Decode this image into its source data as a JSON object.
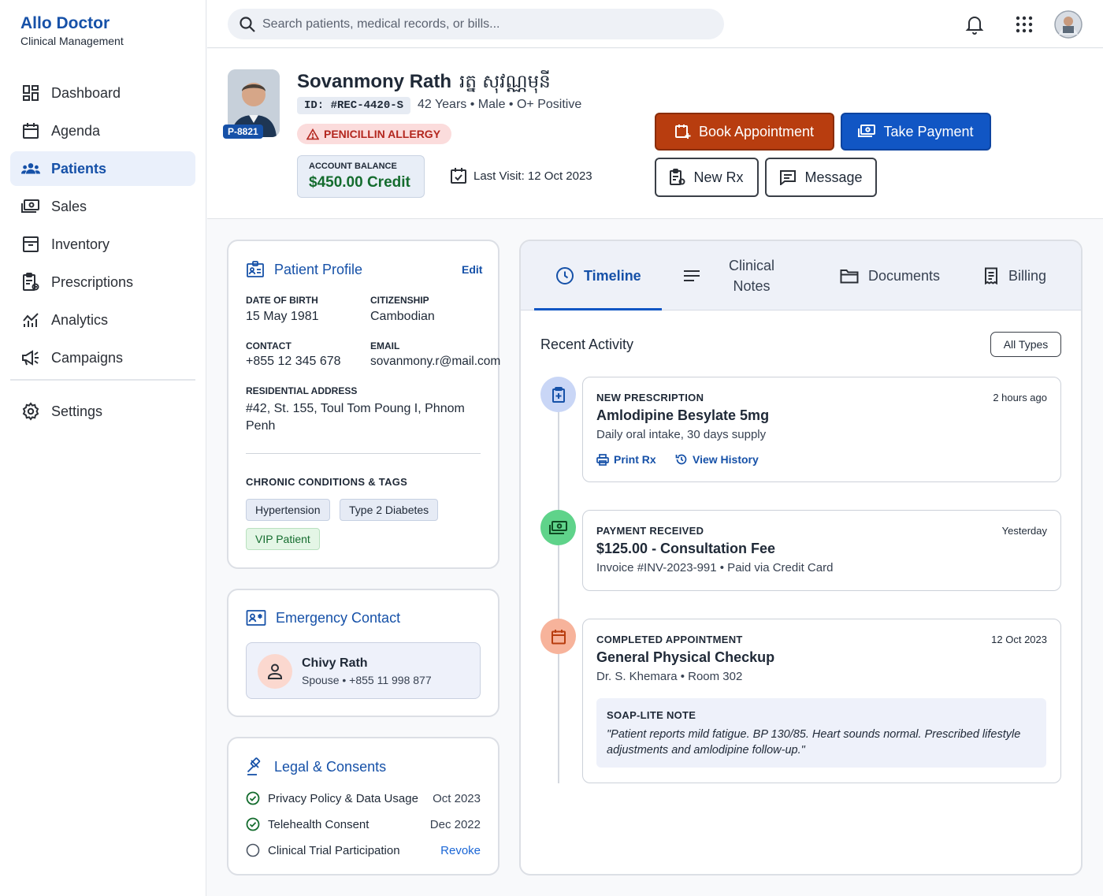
{
  "app": {
    "title": "Allo Doctor",
    "subtitle": "Clinical Management"
  },
  "sidebar": {
    "items": [
      {
        "label": "Dashboard",
        "icon": "dashboard-icon"
      },
      {
        "label": "Agenda",
        "icon": "calendar-icon"
      },
      {
        "label": "Patients",
        "icon": "group-icon",
        "active": true
      },
      {
        "label": "Sales",
        "icon": "cash-icon"
      },
      {
        "label": "Inventory",
        "icon": "archive-icon"
      },
      {
        "label": "Prescriptions",
        "icon": "prescription-icon"
      },
      {
        "label": "Analytics",
        "icon": "analytics-icon"
      },
      {
        "label": "Campaigns",
        "icon": "megaphone-icon"
      }
    ],
    "settings_label": "Settings"
  },
  "search": {
    "placeholder": "Search patients, medical records, or bills..."
  },
  "patient": {
    "name": "Sovanmony Rath",
    "name_khmer": "រត្ន សុវណ្ណមុនី",
    "photo_badge": "P-8821",
    "record_id": "ID: #REC-4420-S",
    "age": "42 Years",
    "sex": "Male",
    "blood": "O+ Positive",
    "allergy": "PENICILLIN ALLERGY",
    "balance_label": "ACCOUNT BALANCE",
    "balance_value": "$450.00 Credit",
    "last_visit": "Last Visit: 12 Oct 2023"
  },
  "actions": {
    "book": "Book Appointment",
    "pay": "Take Payment",
    "new_rx": "New Rx",
    "message": "Message"
  },
  "profile": {
    "title": "Patient Profile",
    "edit": "Edit",
    "dob_label": "DATE OF BIRTH",
    "dob": "15 May 1981",
    "citizenship_label": "CITIZENSHIP",
    "citizenship": "Cambodian",
    "contact_label": "CONTACT",
    "contact": "+855 12 345 678",
    "email_label": "EMAIL",
    "email": "sovanmony.r@mail.com",
    "address_label": "RESIDENTIAL ADDRESS",
    "address": "#42, St. 155, Toul Tom Poung I, Phnom Penh",
    "conditions_label": "CHRONIC CONDITIONS & TAGS",
    "tags": [
      "Hypertension",
      "Type 2 Diabetes",
      "VIP Patient"
    ]
  },
  "emergency": {
    "title": "Emergency Contact",
    "name": "Chivy Rath",
    "relation": "Spouse",
    "phone": "+855 11 998 877"
  },
  "legal": {
    "title": "Legal & Consents",
    "items": [
      {
        "label": "Privacy Policy & Data Usage",
        "date": "Oct 2023",
        "status": "signed"
      },
      {
        "label": "Telehealth Consent",
        "date": "Dec 2022",
        "status": "signed"
      },
      {
        "label": "Clinical Trial Participation",
        "action": "Revoke",
        "status": "pending"
      }
    ]
  },
  "tabs": [
    {
      "label": "Timeline",
      "active": true
    },
    {
      "label": "Clinical\nNotes"
    },
    {
      "label": "Documents"
    },
    {
      "label": "Billing"
    }
  ],
  "timeline": {
    "title": "Recent Activity",
    "filter": "All Types",
    "events": [
      {
        "type": "NEW PRESCRIPTION",
        "time": "2 hours ago",
        "title": "Amlodipine Besylate 5mg",
        "subtitle": "Daily oral intake, 30 days supply",
        "links": [
          "Print Rx",
          "View History"
        ],
        "color": "#c9d6f6"
      },
      {
        "type": "PAYMENT RECEIVED",
        "time": "Yesterday",
        "title": "$125.00 - Consultation Fee",
        "subtitle": "Invoice #INV-2023-991 • Paid via Credit Card",
        "color": "#5fd38a"
      },
      {
        "type": "COMPLETED APPOINTMENT",
        "time": "12 Oct 2023",
        "title": "General Physical Checkup",
        "subtitle": "Dr. S. Khemara • Room 302",
        "note_label": "SOAP-LITE NOTE",
        "note": "\"Patient reports mild fatigue. BP 130/85. Heart sounds normal. Prescribed lifestyle adjustments and amlodipine follow-up.\"",
        "color": "#f7b39b"
      }
    ]
  }
}
